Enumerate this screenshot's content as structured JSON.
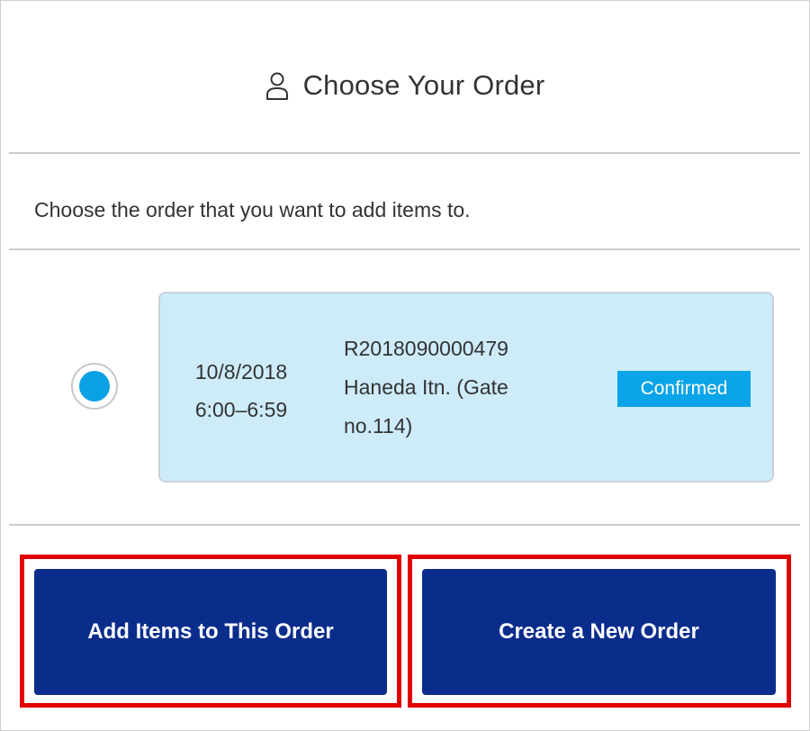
{
  "header": {
    "title": "Choose Your Order",
    "icon": "user-icon"
  },
  "instruction": "Choose the order that you want to add items to.",
  "order": {
    "selected": true,
    "date": "10/8/2018",
    "time": "6:00–6:59",
    "number": "R2018090000479",
    "location_line1": "Haneda Itn. (Gate",
    "location_line2": "no.114)",
    "status": "Confirmed"
  },
  "buttons": {
    "add_items": "Add Items to This Order",
    "create_new": "Create a New Order"
  },
  "colors": {
    "accent": "#0aa0e6",
    "card_bg": "#cdebf9",
    "button_bg": "#0a2d8c",
    "highlight": "#e00000",
    "status_bg": "#0aa4e8"
  }
}
